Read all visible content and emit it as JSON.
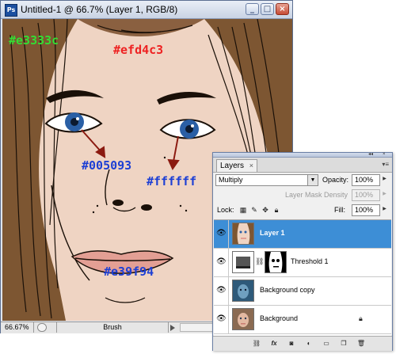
{
  "document_window": {
    "title": "Untitled-1 @ 66.7% (Layer 1, RGB/8)",
    "app_icon": "Ps",
    "buttons": {
      "minimize": "_",
      "maximize": "□",
      "close": "×"
    },
    "status": {
      "zoom": "66.67%",
      "tool": "Brush"
    }
  },
  "annotations": {
    "hair": "#e3333c",
    "skin": "#efd4c3",
    "iris": "#005093",
    "eye_white": "#ffffff",
    "lips": "#e39f94"
  },
  "colors": {
    "skin": "#efd4c3",
    "hair": "#7d5632",
    "iris": "#2a5fa5",
    "lips": "#e39f94",
    "selection": "#3d8ed6"
  },
  "layers_panel": {
    "tab_label": "Layers",
    "tab_close": "×",
    "blend_mode": "Multiply",
    "opacity_label": "Opacity:",
    "opacity_value": "100%",
    "mask_density_label": "Layer Mask Density",
    "mask_density_value": "100%",
    "lock_label": "Lock:",
    "fill_label": "Fill:",
    "fill_value": "100%",
    "layers": [
      {
        "name": "Layer 1",
        "selected": true,
        "visible": true
      },
      {
        "name": "Threshold 1",
        "selected": false,
        "visible": true
      },
      {
        "name": "Background copy",
        "selected": false,
        "visible": true
      },
      {
        "name": "Background",
        "selected": false,
        "visible": true,
        "locked": true
      }
    ],
    "footer_icons": [
      "link-icon",
      "fx-icon",
      "mask-icon",
      "adjustment-icon",
      "group-icon",
      "new-layer-icon",
      "trash-icon"
    ]
  }
}
